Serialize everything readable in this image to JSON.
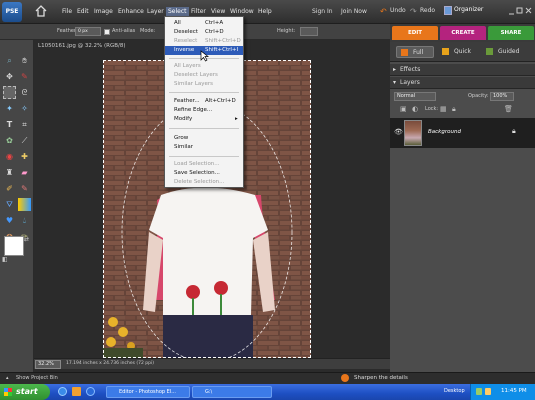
{
  "app": {
    "logo": "PSE"
  },
  "menubar": {
    "items": [
      "File",
      "Edit",
      "Image",
      "Enhance",
      "Layer",
      "Select",
      "Filter",
      "View",
      "Window",
      "Help"
    ],
    "active": "Select",
    "links": [
      "Sign In",
      "Join Now"
    ],
    "undo": "Undo",
    "redo": "Redo",
    "organizer": "Organizer"
  },
  "options": {
    "feather_label": "Feather:",
    "feather_value": "0 px",
    "antialias_label": "Anti-alias",
    "mode_label": "Mode:",
    "height_label": "Height:"
  },
  "modes": {
    "tabs": [
      "EDIT",
      "CREATE",
      "SHARE"
    ],
    "colors": [
      "#e8761b",
      "#b4237e",
      "#3a9a3a"
    ]
  },
  "edit_modes": [
    "Full",
    "Quick",
    "Guided"
  ],
  "select_menu": {
    "items": [
      {
        "label": "All",
        "shortcut": "Ctrl+A",
        "disabled": false
      },
      {
        "label": "Deselect",
        "shortcut": "Ctrl+D",
        "disabled": false
      },
      {
        "label": "Reselect",
        "shortcut": "Shift+Ctrl+D",
        "disabled": true
      },
      {
        "label": "Inverse",
        "shortcut": "Shift+Ctrl+I",
        "disabled": false,
        "highlighted": true
      },
      {
        "label": "All Layers",
        "shortcut": "",
        "disabled": true
      },
      {
        "label": "Deselect Layers",
        "shortcut": "",
        "disabled": true
      },
      {
        "label": "Similar Layers",
        "shortcut": "",
        "disabled": true
      },
      {
        "label": "Feather...",
        "shortcut": "Alt+Ctrl+D",
        "disabled": false
      },
      {
        "label": "Refine Edge...",
        "shortcut": "",
        "disabled": false
      },
      {
        "label": "Modify",
        "shortcut": "",
        "disabled": false,
        "submenu": true
      },
      {
        "label": "Grow",
        "shortcut": "",
        "disabled": false
      },
      {
        "label": "Similar",
        "shortcut": "",
        "disabled": false
      },
      {
        "label": "Load Selection...",
        "shortcut": "",
        "disabled": true
      },
      {
        "label": "Save Selection...",
        "shortcut": "",
        "disabled": false
      },
      {
        "label": "Delete Selection...",
        "shortcut": "",
        "disabled": true
      }
    ]
  },
  "document": {
    "title": "L1050161.jpg @ 32.2% (RGB/8)",
    "zoom": "32.2%",
    "info": "17.194 inches x 24.736 inches (72 ppi)"
  },
  "panels": {
    "effects": "Effects",
    "layers": "Layers",
    "blend_mode": "Normal",
    "opacity_label": "Opacity:",
    "opacity_value": "100%",
    "lock_label": "Lock:",
    "layer_name": "Background"
  },
  "bottom": {
    "project_bin": "Show Project Bin",
    "hint": "Sharpen the details"
  },
  "taskbar": {
    "start": "start",
    "tasks": [
      "Editor - Photoshop El...",
      "G:\\"
    ],
    "desktop": "Desktop",
    "clock": "11:45 PM"
  },
  "colors": {
    "accent": "#2d5bb8",
    "edit_tab": "#e8761b",
    "create_tab": "#b4237e",
    "share_tab": "#3a9a3a"
  }
}
